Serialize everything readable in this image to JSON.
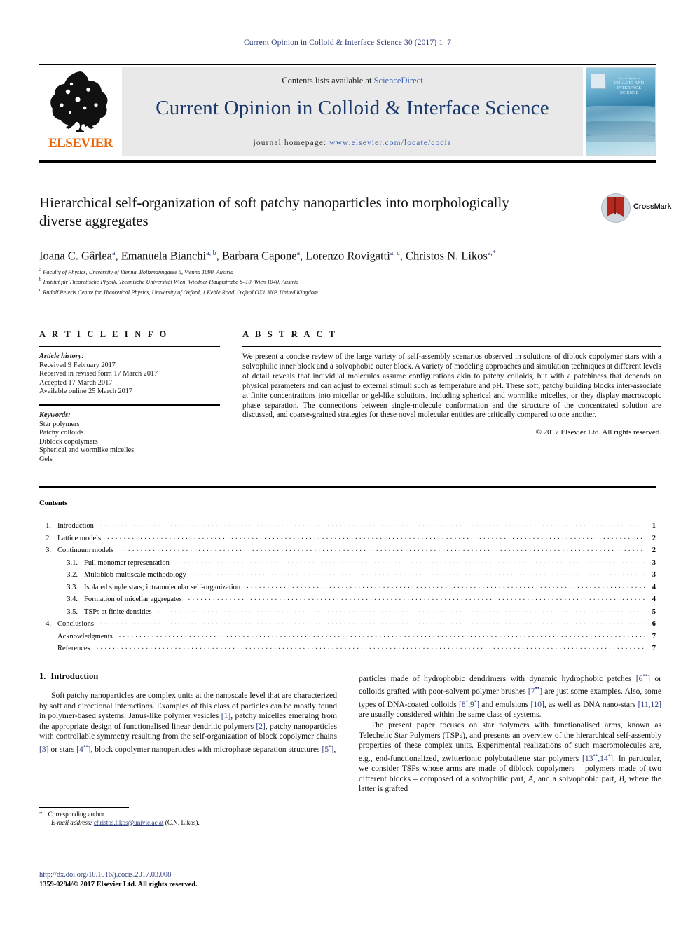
{
  "running_head": "Current Opinion in Colloid & Interface Science 30 (2017) 1–7",
  "masthead": {
    "contents_prefix": "Contents lists available at ",
    "sciencedirect": "ScienceDirect",
    "journal_title": "Current Opinion in Colloid & Interface Science",
    "homepage_prefix": "journal homepage: ",
    "homepage_url": "www.elsevier.com/locate/cocis",
    "publisher": "ELSEVIER",
    "cover_title_small": "Current Opinion in",
    "cover_title": "COLLOID AND INTERFACE SCIENCE",
    "brand_orange": "#ec6608",
    "link_blue": "#3a63b8",
    "title_navy": "#1b3a6b"
  },
  "article": {
    "title": "Hierarchical self-organization of soft patchy nanoparticles into morphologically diverse aggregates",
    "crossmark_label": "CrossMark",
    "authors_html": "Ioana C. Gârlea<sup>a</sup>, Emanuela Bianchi<sup>a, b</sup>, Barbara Capone<sup>a</sup>, Lorenzo Rovigatti<sup>a, c</sup>, Christos N. Likos<sup>a,</sup><sup>*</sup>",
    "affiliations": [
      {
        "mark": "a",
        "text": "Faculty of Physics, University of Vienna, Boltzmanngasse 5, Vienna 1090, Austria"
      },
      {
        "mark": "b",
        "text": "Institut für Theoretische Physik, Technische Universität Wien, Wiedner Hauptstraße 8–10, Wien 1040, Austria"
      },
      {
        "mark": "c",
        "text": "Rudolf Peierls Centre for Theoretical Physics, University of Oxford, 1 Keble Road, Oxford OX1 3NP, United Kingdom"
      }
    ]
  },
  "article_info": {
    "heading": "A R T I C L E   I N F O",
    "history_label": "Article history:",
    "history": [
      "Received 9 February 2017",
      "Received in revised form 17 March 2017",
      "Accepted 17 March 2017",
      "Available online 25 March 2017"
    ],
    "keywords_label": "Keywords:",
    "keywords": [
      "Star polymers",
      "Patchy colloids",
      "Diblock copolymers",
      "Spherical and wormlike micelles",
      "Gels"
    ]
  },
  "abstract": {
    "heading": "A B S T R A C T",
    "text": "We present a concise review of the large variety of self-assembly scenarios observed in solutions of diblock copolymer stars with a solvophilic inner block and a solvophobic outer block. A variety of modeling approaches and simulation techniques at different levels of detail reveals that individual molecules assume configurations akin to patchy colloids, but with a patchiness that depends on physical parameters and can adjust to external stimuli such as temperature and pH. These soft, patchy building blocks inter-associate at finite concentrations into micellar or gel-like solutions, including spherical and wormlike micelles, or they display macroscopic phase separation. The connections between single-molecule conformation and the structure of the concentrated solution are discussed, and coarse-grained strategies for these novel molecular entities are critically compared to one another.",
    "copyright": "© 2017 Elsevier Ltd. All rights reserved."
  },
  "contents": {
    "heading": "Contents",
    "entries": [
      {
        "num": "1.",
        "label": "Introduction",
        "page": "1",
        "sub": false
      },
      {
        "num": "2.",
        "label": "Lattice models",
        "page": "2",
        "sub": false
      },
      {
        "num": "3.",
        "label": "Continuum models",
        "page": "2",
        "sub": false
      },
      {
        "num": "3.1.",
        "label": "Full monomer representation",
        "page": "3",
        "sub": true
      },
      {
        "num": "3.2.",
        "label": "Multiblob multiscale methodology",
        "page": "3",
        "sub": true
      },
      {
        "num": "3.3.",
        "label": "Isolated single stars; intramolecular self-organization",
        "page": "4",
        "sub": true
      },
      {
        "num": "3.4.",
        "label": "Formation of micellar aggregates",
        "page": "4",
        "sub": true
      },
      {
        "num": "3.5.",
        "label": "TSPs at finite densities",
        "page": "5",
        "sub": true
      },
      {
        "num": "4.",
        "label": "Conclusions",
        "page": "6",
        "sub": false
      },
      {
        "num": "",
        "label": "Acknowledgments",
        "page": "7",
        "sub": false
      },
      {
        "num": "",
        "label": "References",
        "page": "7",
        "sub": false
      }
    ]
  },
  "body": {
    "section_number": "1.",
    "section_title": "Introduction",
    "left_paragraph_html": "Soft patchy nanoparticles are complex units at the nanoscale level that are characterized by soft and directional interactions. Examples of this class of particles can be mostly found in polymer-based systems: Janus-like polymer vesicles <span class=\"ref\">[1]</span>, patchy micelles emerging from the appropriate design of functionalised linear dendritic polymers <span class=\"ref\">[2]</span>, patchy nanoparticles with controllable symmetry resulting from the self-organization of block copolymer chains <span class=\"ref\">[3]</span> or stars <span class=\"ref\">[4<sup>••</sup>]</span>, block copolymer nanoparticles with microphase separation structures <span class=\"ref\">[5<sup>•</sup>]</span>,",
    "right_paragraph_1_html": "particles made of hydrophobic dendrimers with dynamic hydrophobic patches <span class=\"ref\">[6<sup>••</sup>]</span> or colloids grafted with poor-solvent polymer brushes <span class=\"ref\">[7<sup>••</sup>]</span> are just some examples. Also, some types of DNA-coated colloids <span class=\"ref\">[8<sup>•</sup>,9<sup>•</sup>]</span> and emulsions <span class=\"ref\">[10]</span>, as well as DNA nano-stars <span class=\"ref\">[11,12]</span> are usually considered within the same class of systems.",
    "right_paragraph_2_html": "The present paper focuses on star polymers with functionalised arms, known as Telechelic Star Polymers (TSPs), and presents an overview of the hierarchical self-assembly properties of these complex units. Experimental realizations of such macromolecules are, e.g., end-functionalized, zwitterionic polybutadiene star polymers <span class=\"ref\">[13<sup>••</sup>,14<sup>•</sup>]</span>. In particular, we consider TSPs whose arms are made of diblock copolymers – polymers made of two different blocks – composed of a solvophilic part, <i>A</i>, and a solvophobic part, <i>B</i>, where the latter is grafted"
  },
  "footnote": {
    "corresponding": "Corresponding author.",
    "email_label": "E-mail address:",
    "email": "christos.likos@univie.ac.at",
    "email_suffix": "(C.N. Likos)."
  },
  "footer": {
    "doi": "http://dx.doi.org/10.1016/j.cocis.2017.03.008",
    "issn_line": "1359-0294/© 2017 Elsevier Ltd. All rights reserved."
  }
}
